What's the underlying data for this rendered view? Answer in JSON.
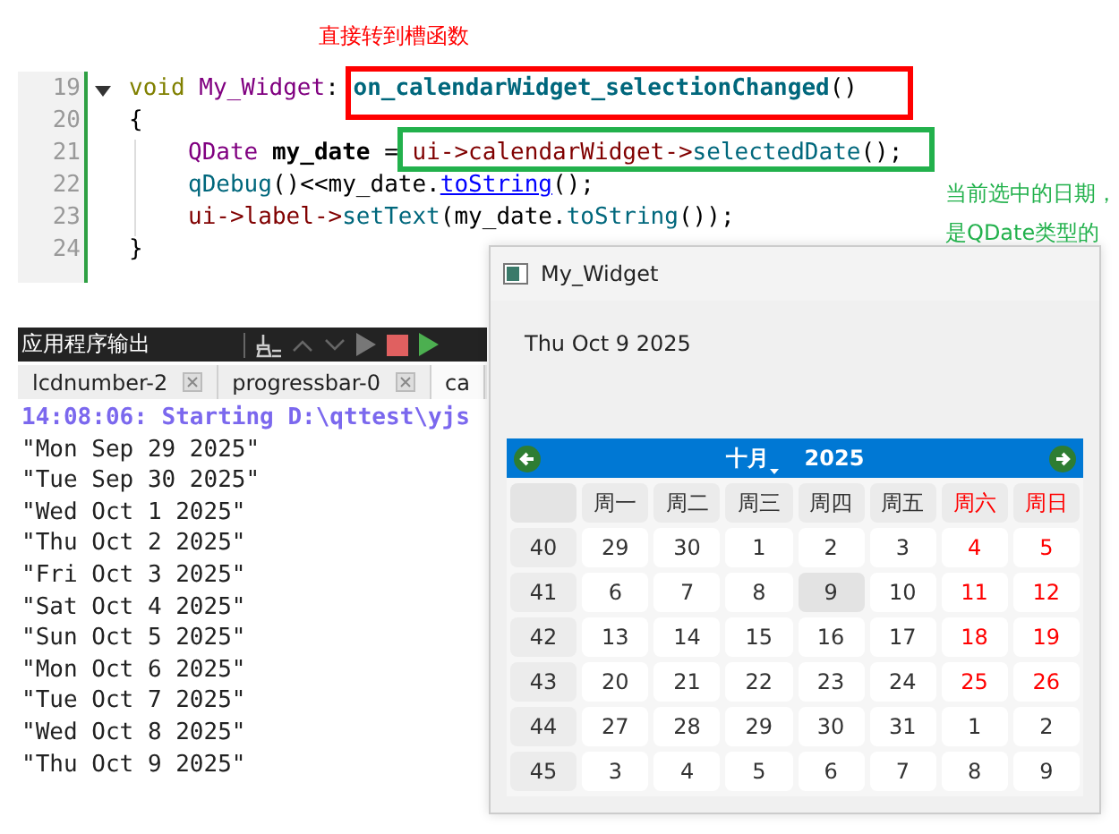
{
  "annotations": [
    {
      "text": "直接转到槽函数",
      "color": "#ff0000"
    },
    {
      "text": "当前选中的日期，是QDate类型的",
      "color": "#22b14c"
    }
  ],
  "editor": {
    "lines": [
      {
        "number": "19",
        "foldable": true,
        "indented": false,
        "tokens": [
          {
            "kind": "keyword",
            "text": "void "
          },
          {
            "kind": "type",
            "text": "My_Widget"
          },
          {
            "kind": "plain",
            "text": ": "
          },
          {
            "kind": "fndef",
            "text": "on_calendarWidget_selectionChanged"
          },
          {
            "kind": "plain",
            "text": "()"
          }
        ]
      },
      {
        "number": "20",
        "foldable": false,
        "indented": false,
        "tokens": [
          {
            "kind": "plain",
            "text": "{"
          }
        ]
      },
      {
        "number": "21",
        "foldable": false,
        "indented": true,
        "tokens": [
          {
            "kind": "type",
            "text": "QDate"
          },
          {
            "kind": "var",
            "text": " my_date"
          },
          {
            "kind": "plain",
            "text": " = "
          },
          {
            "kind": "member",
            "text": "ui->calendarWidget->"
          },
          {
            "kind": "fn",
            "text": "selectedDate"
          },
          {
            "kind": "plain",
            "text": "();"
          }
        ]
      },
      {
        "number": "22",
        "foldable": false,
        "indented": true,
        "tokens": [
          {
            "kind": "fn",
            "text": "qDebug"
          },
          {
            "kind": "plain",
            "text": "()<<my_date."
          },
          {
            "kind": "link",
            "text": "toString"
          },
          {
            "kind": "plain",
            "text": "();"
          }
        ]
      },
      {
        "number": "23",
        "foldable": false,
        "indented": true,
        "tokens": [
          {
            "kind": "member",
            "text": "ui->label->"
          },
          {
            "kind": "fn",
            "text": "setText"
          },
          {
            "kind": "plain",
            "text": "(my_date."
          },
          {
            "kind": "fn",
            "text": "toString"
          },
          {
            "kind": "plain",
            "text": "());"
          }
        ]
      },
      {
        "number": "24",
        "foldable": false,
        "indented": false,
        "tokens": [
          {
            "kind": "plain",
            "text": "}"
          }
        ]
      }
    ]
  },
  "output": {
    "title": "应用程序输出",
    "tabs": [
      {
        "label": "lcdnumber-2",
        "selected": false,
        "closable": true
      },
      {
        "label": "progressbar-0",
        "selected": false,
        "closable": true
      },
      {
        "label": "ca",
        "selected": true,
        "closable": false
      }
    ],
    "lines": [
      {
        "kind": "status",
        "text": "14:08:06: Starting D:\\qttest\\yjs"
      },
      {
        "kind": "log",
        "text": "\"Mon Sep 29 2025\""
      },
      {
        "kind": "log",
        "text": "\"Tue Sep 30 2025\""
      },
      {
        "kind": "log",
        "text": "\"Wed Oct 1 2025\""
      },
      {
        "kind": "log",
        "text": "\"Thu Oct 2 2025\""
      },
      {
        "kind": "log",
        "text": "\"Fri Oct 3 2025\""
      },
      {
        "kind": "log",
        "text": "\"Sat Oct 4 2025\""
      },
      {
        "kind": "log",
        "text": "\"Sun Oct 5 2025\""
      },
      {
        "kind": "log",
        "text": "\"Mon Oct 6 2025\""
      },
      {
        "kind": "log",
        "text": "\"Tue Oct 7 2025\""
      },
      {
        "kind": "log",
        "text": "\"Wed Oct 8 2025\""
      },
      {
        "kind": "log",
        "text": "\"Thu Oct 9 2025\""
      }
    ]
  },
  "widget": {
    "title": "My_Widget",
    "label": "Thu Oct 9 2025",
    "calendar": {
      "month": "十月",
      "year": "2025",
      "weekdays": [
        {
          "label": "周一",
          "color": "#333333"
        },
        {
          "label": "周二",
          "color": "#333333"
        },
        {
          "label": "周三",
          "color": "#333333"
        },
        {
          "label": "周四",
          "color": "#333333"
        },
        {
          "label": "周五",
          "color": "#333333"
        },
        {
          "label": "周六",
          "color": "#ff0000"
        },
        {
          "label": "周日",
          "color": "#ff0000"
        }
      ],
      "weeks": [
        {
          "number": "40",
          "days": [
            {
              "text": "29",
              "color": "#333333",
              "selected": false
            },
            {
              "text": "30",
              "color": "#333333",
              "selected": false
            },
            {
              "text": "1",
              "color": "#333333",
              "selected": false
            },
            {
              "text": "2",
              "color": "#333333",
              "selected": false
            },
            {
              "text": "3",
              "color": "#333333",
              "selected": false
            },
            {
              "text": "4",
              "color": "#ff0000",
              "selected": false
            },
            {
              "text": "5",
              "color": "#ff0000",
              "selected": false
            }
          ]
        },
        {
          "number": "41",
          "days": [
            {
              "text": "6",
              "color": "#333333",
              "selected": false
            },
            {
              "text": "7",
              "color": "#333333",
              "selected": false
            },
            {
              "text": "8",
              "color": "#333333",
              "selected": false
            },
            {
              "text": "9",
              "color": "#333333",
              "selected": true
            },
            {
              "text": "10",
              "color": "#333333",
              "selected": false
            },
            {
              "text": "11",
              "color": "#ff0000",
              "selected": false
            },
            {
              "text": "12",
              "color": "#ff0000",
              "selected": false
            }
          ]
        },
        {
          "number": "42",
          "days": [
            {
              "text": "13",
              "color": "#333333",
              "selected": false
            },
            {
              "text": "14",
              "color": "#333333",
              "selected": false
            },
            {
              "text": "15",
              "color": "#333333",
              "selected": false
            },
            {
              "text": "16",
              "color": "#333333",
              "selected": false
            },
            {
              "text": "17",
              "color": "#333333",
              "selected": false
            },
            {
              "text": "18",
              "color": "#ff0000",
              "selected": false
            },
            {
              "text": "19",
              "color": "#ff0000",
              "selected": false
            }
          ]
        },
        {
          "number": "43",
          "days": [
            {
              "text": "20",
              "color": "#333333",
              "selected": false
            },
            {
              "text": "21",
              "color": "#333333",
              "selected": false
            },
            {
              "text": "22",
              "color": "#333333",
              "selected": false
            },
            {
              "text": "23",
              "color": "#333333",
              "selected": false
            },
            {
              "text": "24",
              "color": "#333333",
              "selected": false
            },
            {
              "text": "25",
              "color": "#ff0000",
              "selected": false
            },
            {
              "text": "26",
              "color": "#ff0000",
              "selected": false
            }
          ]
        },
        {
          "number": "44",
          "days": [
            {
              "text": "27",
              "color": "#333333",
              "selected": false
            },
            {
              "text": "28",
              "color": "#333333",
              "selected": false
            },
            {
              "text": "29",
              "color": "#333333",
              "selected": false
            },
            {
              "text": "30",
              "color": "#333333",
              "selected": false
            },
            {
              "text": "31",
              "color": "#333333",
              "selected": false
            },
            {
              "text": "1",
              "color": "#333333",
              "selected": false
            },
            {
              "text": "2",
              "color": "#333333",
              "selected": false
            }
          ]
        },
        {
          "number": "45",
          "days": [
            {
              "text": "3",
              "color": "#333333",
              "selected": false
            },
            {
              "text": "4",
              "color": "#333333",
              "selected": false
            },
            {
              "text": "5",
              "color": "#333333",
              "selected": false
            },
            {
              "text": "6",
              "color": "#333333",
              "selected": false
            },
            {
              "text": "7",
              "color": "#333333",
              "selected": false
            },
            {
              "text": "8",
              "color": "#333333",
              "selected": false
            },
            {
              "text": "9",
              "color": "#333333",
              "selected": false
            }
          ]
        }
      ]
    }
  }
}
